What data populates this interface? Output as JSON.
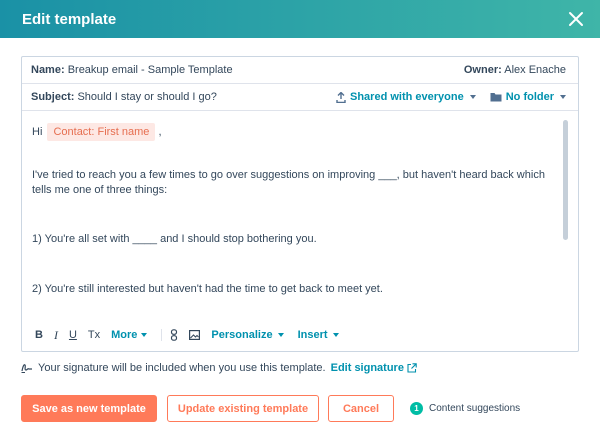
{
  "dialog": {
    "title": "Edit template"
  },
  "template": {
    "name_label": "Name:",
    "name_value": "Breakup email - Sample Template",
    "owner_label": "Owner:",
    "owner_value": "Alex Enache",
    "subject_label": "Subject:",
    "subject_value": "Should I stay or should I go?",
    "sharing": "Shared with everyone",
    "folder": "No folder"
  },
  "body": {
    "greeting": "Hi",
    "token": "Contact: First name",
    "greeting_end": ",",
    "p1": "I've tried to reach you a few times to go over suggestions on improving ___, but haven't heard back which tells me one of three things:",
    "p2": "1) You're all set with ____ and I should stop bothering you.",
    "p3": "2) You're still interested but haven't had the time to get back to meet yet."
  },
  "toolbar": {
    "bold": "B",
    "italic": "I",
    "underline": "U",
    "clear": "Tx",
    "more": "More",
    "personalize": "Personalize",
    "insert": "Insert"
  },
  "signature": {
    "text": "Your signature will be included when you use this template.",
    "link": "Edit signature"
  },
  "footer": {
    "save_new": "Save as new template",
    "update": "Update existing template",
    "cancel": "Cancel",
    "suggestions_count": "1",
    "suggestions_label": "Content suggestions"
  },
  "colors": {
    "header_start": "#1a91a6",
    "header_end": "#3fb5a8",
    "accent": "#ff7a59",
    "link": "#0091ae",
    "token_bg": "#fde8e4",
    "token_text": "#e66e50"
  }
}
